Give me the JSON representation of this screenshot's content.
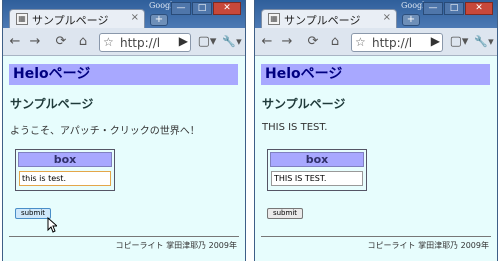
{
  "windows": [
    {
      "tab": {
        "title": "サンプルページ",
        "close": "×"
      },
      "brand": "Google",
      "newtab": "+",
      "window_buttons": {
        "minimize": "—",
        "maximize": "□",
        "close": "✕"
      },
      "toolbar": {
        "back": "←",
        "forward": "→",
        "reload": "⟳",
        "home": "⌂",
        "star": "☆",
        "url": "http://l",
        "go": "▶",
        "page": "▢▾",
        "wrench": "🔧▾"
      },
      "page": {
        "heading": "Heloページ",
        "subheading": "サンプルページ",
        "message": "ようこそ、アパッチ・クリックの世界へ！",
        "box_title": "box",
        "input_value": "this is test.",
        "submit_label": "submit",
        "footer": "コピーライト 掌田津耶乃 2009年"
      }
    },
    {
      "tab": {
        "title": "サンプルページ",
        "close": "×"
      },
      "brand": "Google",
      "newtab": "+",
      "window_buttons": {
        "minimize": "—",
        "maximize": "□",
        "close": "✕"
      },
      "toolbar": {
        "back": "←",
        "forward": "→",
        "reload": "⟳",
        "home": "⌂",
        "star": "☆",
        "url": "http://l",
        "go": "▶",
        "page": "▢▾",
        "wrench": "🔧▾"
      },
      "page": {
        "heading": "Heloページ",
        "subheading": "サンプルページ",
        "message": "THIS IS TEST.",
        "box_title": "box",
        "input_value": "THIS IS TEST.",
        "submit_label": "submit",
        "footer": "コピーライト 掌田津耶乃 2009年"
      }
    }
  ]
}
